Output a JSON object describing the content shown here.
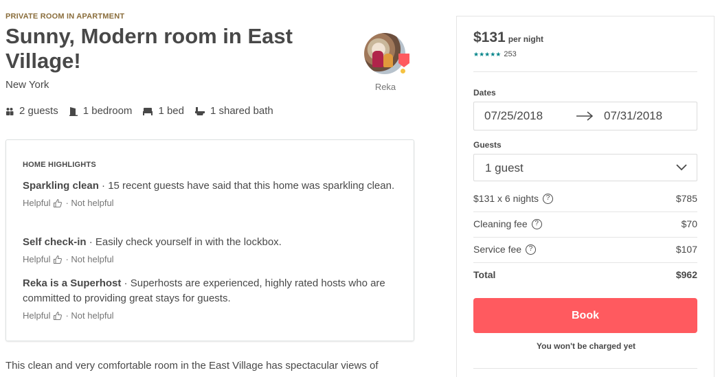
{
  "listing": {
    "room_type": "PRIVATE ROOM IN APARTMENT",
    "title": "Sunny, Modern room in East Village!",
    "city": "New York",
    "host_name": "Reka",
    "amenities": [
      {
        "icon": "guests-icon",
        "label": "2 guests"
      },
      {
        "icon": "door-icon",
        "label": "1 bedroom"
      },
      {
        "icon": "bed-icon",
        "label": "1 bed"
      },
      {
        "icon": "bath-icon",
        "label": "1 shared bath"
      }
    ],
    "description": "This clean and very comfortable room in the East Village has spectacular views of"
  },
  "highlights": {
    "heading": "HOME HIGHLIGHTS",
    "items": [
      {
        "title": "Sparkling clean",
        "text": " · 15 recent guests have said that this home was sparkling clean.",
        "helpful": "Helpful",
        "not_helpful": "· Not helpful"
      },
      {
        "title": "Self check-in",
        "text": " · Easily check yourself in with the lockbox.",
        "helpful": "Helpful",
        "not_helpful": "· Not helpful"
      },
      {
        "title": "Reka is a Superhost",
        "text": " · Superhosts are experienced, highly rated hosts who are committed to providing great stays for guests.",
        "helpful": "Helpful",
        "not_helpful": "· Not helpful"
      }
    ]
  },
  "booking": {
    "price": "$131",
    "per_night": "per night",
    "stars": "★★★★★",
    "review_count": "253",
    "dates_label": "Dates",
    "check_in": "07/25/2018",
    "check_out": "07/31/2018",
    "guests_label": "Guests",
    "guests_value": "1 guest",
    "line_items": [
      {
        "label": "$131 x 6 nights",
        "value": "$785",
        "info": true
      },
      {
        "label": "Cleaning fee",
        "value": "$70",
        "info": true
      },
      {
        "label": "Service fee",
        "value": "$107",
        "info": true
      }
    ],
    "total_label": "Total",
    "total_value": "$962",
    "book_label": "Book",
    "not_charged": "You won't be charged yet",
    "colors": {
      "accent": "#ff5a5f",
      "stars": "#008489"
    }
  }
}
